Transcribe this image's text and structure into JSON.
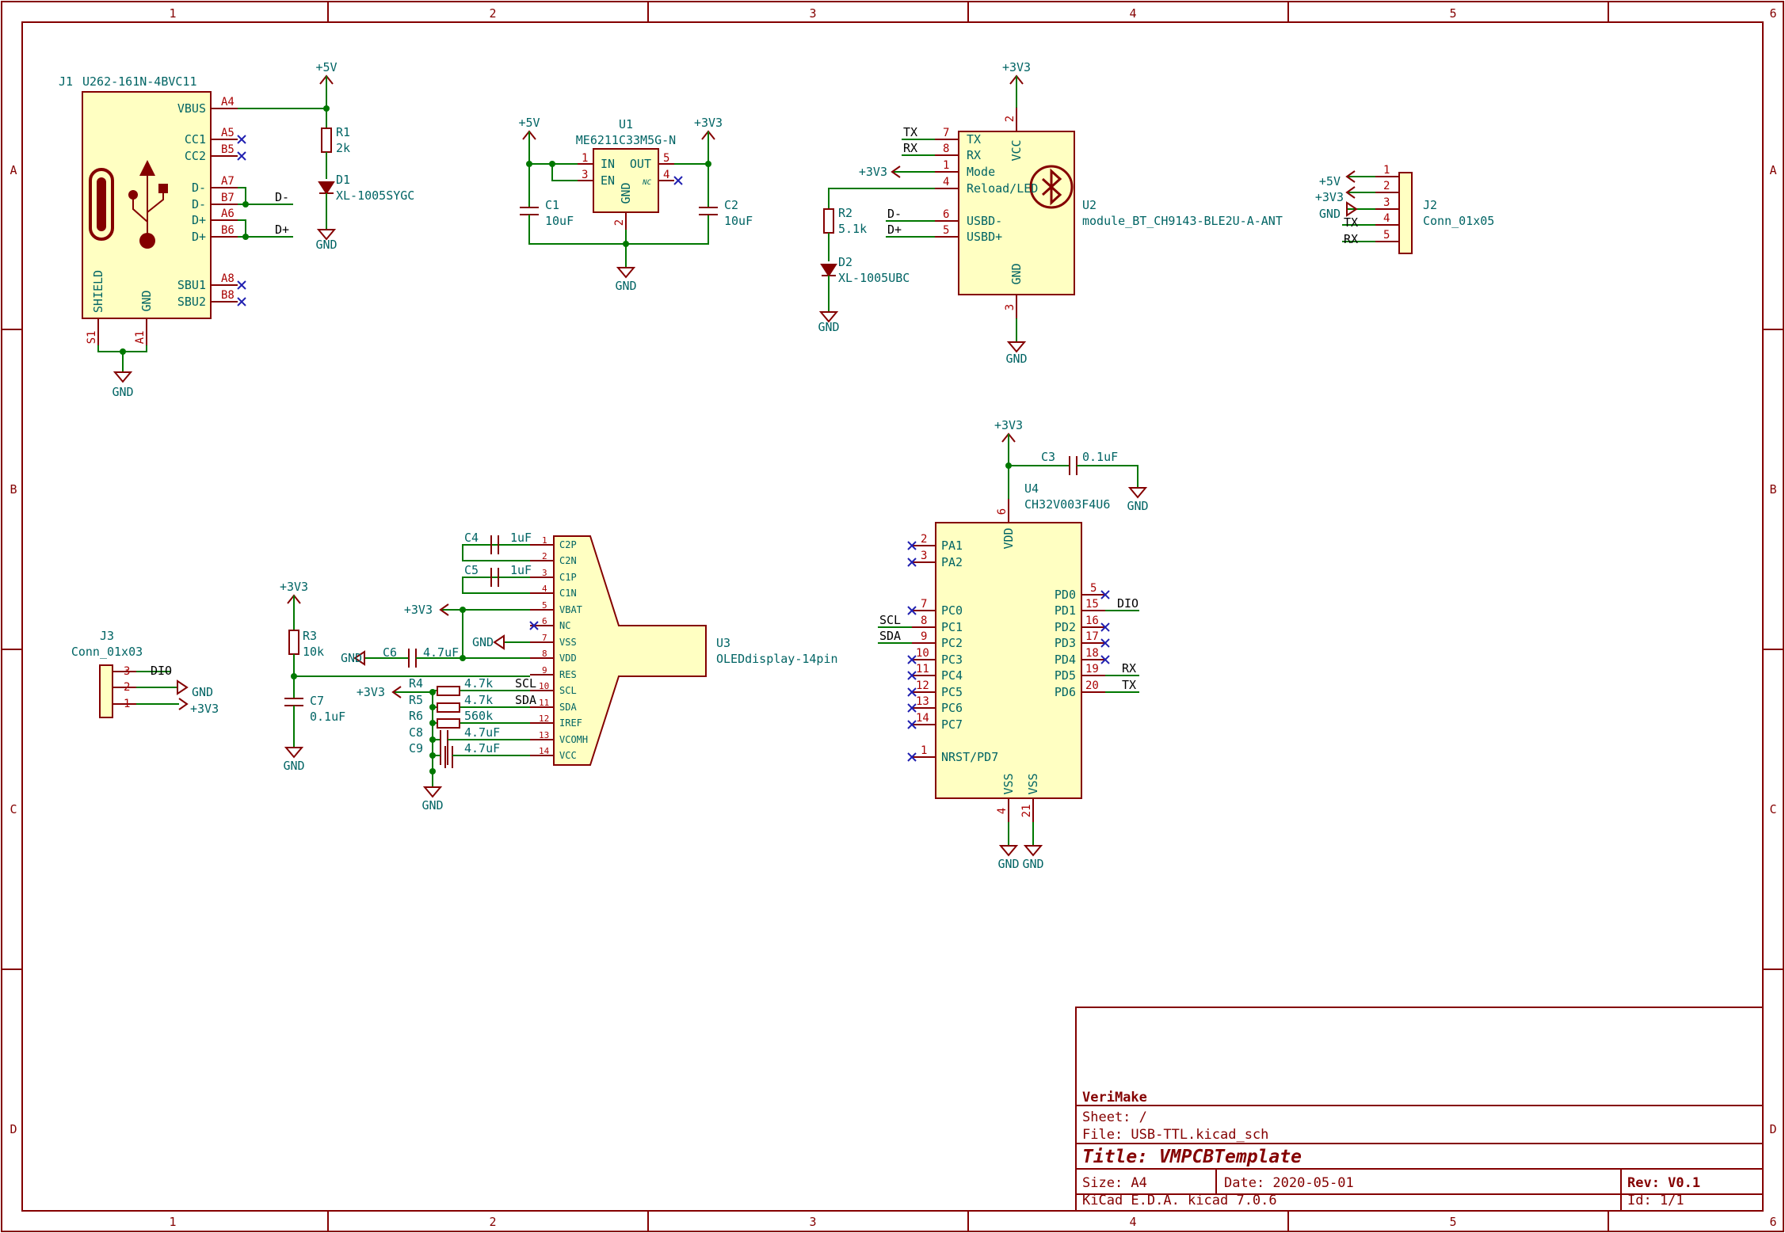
{
  "frame": {
    "columns": [
      "1",
      "2",
      "3",
      "4",
      "5",
      "6"
    ],
    "rows": [
      "A",
      "B",
      "C",
      "D"
    ]
  },
  "title_block": {
    "company": "VeriMake",
    "sheet": "Sheet: /",
    "file": "File: USB-TTL.kicad_sch",
    "title": "Title: VMPCBTemplate",
    "size": "Size: A4",
    "date": "Date: 2020-05-01",
    "rev": "Rev: V0.1",
    "tool": "KiCad E.D.A.  kicad 7.0.6",
    "id": "Id: 1/1"
  },
  "power": {
    "p5v": "+5V",
    "p3v3": "+3V3",
    "gnd": "GND"
  },
  "net_labels": {
    "dm": "D-",
    "dp": "D+",
    "tx": "TX",
    "rx": "RX",
    "scl": "SCL",
    "sda": "SDA",
    "dio": "DIO"
  },
  "components": {
    "j1": {
      "ref": "J1",
      "value": "U262-161N-4BVC11",
      "pin_names": [
        "VBUS",
        "CC1",
        "CC2",
        "D-",
        "D-",
        "D+",
        "D+",
        "SBU1",
        "SBU2",
        "SHIELD",
        "GND"
      ],
      "pin_numbers": [
        "A4",
        "A5",
        "B5",
        "A7",
        "B7",
        "A6",
        "B6",
        "A8",
        "B8",
        "S1",
        "A1"
      ]
    },
    "r1": {
      "ref": "R1",
      "value": "2k"
    },
    "d1": {
      "ref": "D1",
      "value": "XL-1005SYGC"
    },
    "u1": {
      "ref": "U1",
      "value": "ME6211C33M5G-N",
      "pin_names": [
        "IN",
        "EN",
        "OUT",
        "NC",
        "GND"
      ],
      "pin_numbers": [
        "1",
        "3",
        "5",
        "4",
        "2"
      ]
    },
    "c1": {
      "ref": "C1",
      "value": "10uF"
    },
    "c2": {
      "ref": "C2",
      "value": "10uF"
    },
    "u2": {
      "ref": "U2",
      "value": "module_BT_CH9143-BLE2U-A-ANT",
      "pin_names": [
        "TX",
        "RX",
        "Mode",
        "Reload/LED",
        "USBD-",
        "USBD+",
        "VCC",
        "GND"
      ],
      "pin_numbers": [
        "7",
        "8",
        "1",
        "4",
        "6",
        "5",
        "2",
        "3"
      ]
    },
    "r2": {
      "ref": "R2",
      "value": "5.1k"
    },
    "d2": {
      "ref": "D2",
      "value": "XL-1005UBC"
    },
    "j2": {
      "ref": "J2",
      "value": "Conn_01x05",
      "pin_numbers": [
        "1",
        "2",
        "3",
        "4",
        "5"
      ]
    },
    "c3": {
      "ref": "C3",
      "value": "0.1uF"
    },
    "u4": {
      "ref": "U4",
      "value": "CH32V003F4U6",
      "left_pin_names": [
        "PA1",
        "PA2",
        "PC0",
        "PC1",
        "PC2",
        "PC3",
        "PC4",
        "PC5",
        "PC6",
        "PC7",
        "NRST/PD7"
      ],
      "left_pin_numbers": [
        "2",
        "3",
        "7",
        "8",
        "9",
        "10",
        "11",
        "12",
        "13",
        "14",
        "1"
      ],
      "right_pin_names": [
        "PD0",
        "PD1",
        "PD2",
        "PD3",
        "PD4",
        "PD5",
        "PD6"
      ],
      "right_pin_numbers": [
        "5",
        "15",
        "16",
        "17",
        "18",
        "19",
        "20"
      ],
      "vdd": "VDD",
      "vdd_pin": "6",
      "vss": [
        "VSS",
        "VSS"
      ],
      "vss_pins": [
        "4",
        "21"
      ]
    },
    "j3": {
      "ref": "J3",
      "value": "Conn_01x03",
      "pin_numbers": [
        "3",
        "2",
        "1"
      ]
    },
    "r3": {
      "ref": "R3",
      "value": "10k"
    },
    "c7": {
      "ref": "C7",
      "value": "0.1uF"
    },
    "u3": {
      "ref": "U3",
      "value": "OLEDdisplay-14pin",
      "pin_names": [
        "C2P",
        "C2N",
        "C1P",
        "C1N",
        "VBAT",
        "NC",
        "VSS",
        "VDD",
        "RES",
        "SCL",
        "SDA",
        "IREF",
        "VCOMH",
        "VCC"
      ],
      "pin_numbers": [
        "1",
        "2",
        "3",
        "4",
        "5",
        "6",
        "7",
        "8",
        "9",
        "10",
        "11",
        "12",
        "13",
        "14"
      ]
    },
    "c4": {
      "ref": "C4",
      "value": "1uF"
    },
    "c5": {
      "ref": "C5",
      "value": "1uF"
    },
    "c6": {
      "ref": "C6",
      "value": "4.7uF"
    },
    "r4": {
      "ref": "R4",
      "value": "4.7k"
    },
    "r5": {
      "ref": "R5",
      "value": "4.7k"
    },
    "r6": {
      "ref": "R6",
      "value": "560k"
    },
    "c8": {
      "ref": "C8",
      "value": "4.7uF"
    },
    "c9": {
      "ref": "C9",
      "value": "4.7uF"
    }
  }
}
